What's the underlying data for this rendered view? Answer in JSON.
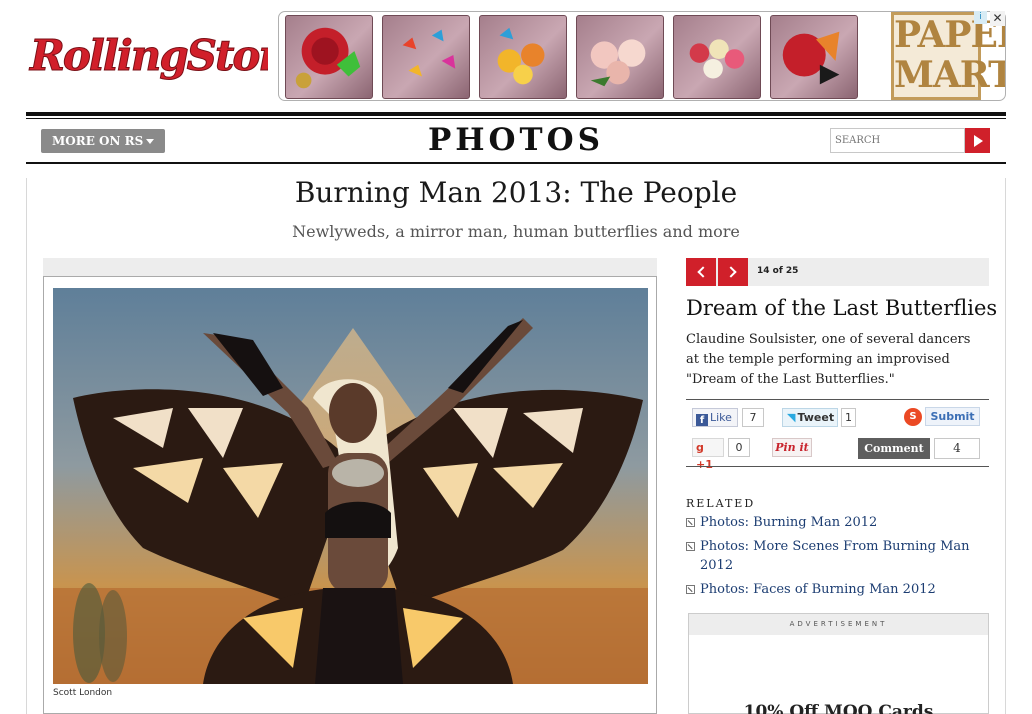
{
  "header": {
    "logo_text": "RollingStone",
    "more_button": "MORE ON RS",
    "section_title": "PHOTOS",
    "search_placeholder": "SEARCH"
  },
  "ad_banner": {
    "brand_line1": "PAPER",
    "brand_line2": "MART",
    "ad_choices_icon": "i",
    "close_icon": "✕"
  },
  "gallery": {
    "title": "Burning Man 2013: The People",
    "subtitle": "Newlyweds, a mirror man, human butterflies and more"
  },
  "photo": {
    "credit": "Scott London"
  },
  "slide": {
    "counter": "14 of 25",
    "title": "Dream of the Last Butterflies",
    "caption": "Claudine Soulsister, one of several dancers at the temple performing an improvised \"Dream of the Last Butterflies.\""
  },
  "social": {
    "like_label": "Like",
    "like_count": "7",
    "tweet_label": "Tweet",
    "tweet_count": "1",
    "submit_label": "Submit",
    "gplus_label": "+1",
    "gplus_count": "0",
    "pin_label": "Pin it",
    "comment_label": "Comment",
    "comment_count": "4"
  },
  "related": {
    "heading": "RELATED",
    "items": [
      {
        "label": "Photos: Burning Man 2012"
      },
      {
        "label": "Photos: More Scenes From Burning Man 2012"
      },
      {
        "label": "Photos: Faces of Burning Man 2012"
      }
    ]
  },
  "advertisement": {
    "label": "ADVERTISEMENT",
    "text": "10% Off MOO Cards"
  },
  "colors": {
    "accent_red": "#d0202a",
    "link_blue": "#1c3d72"
  }
}
